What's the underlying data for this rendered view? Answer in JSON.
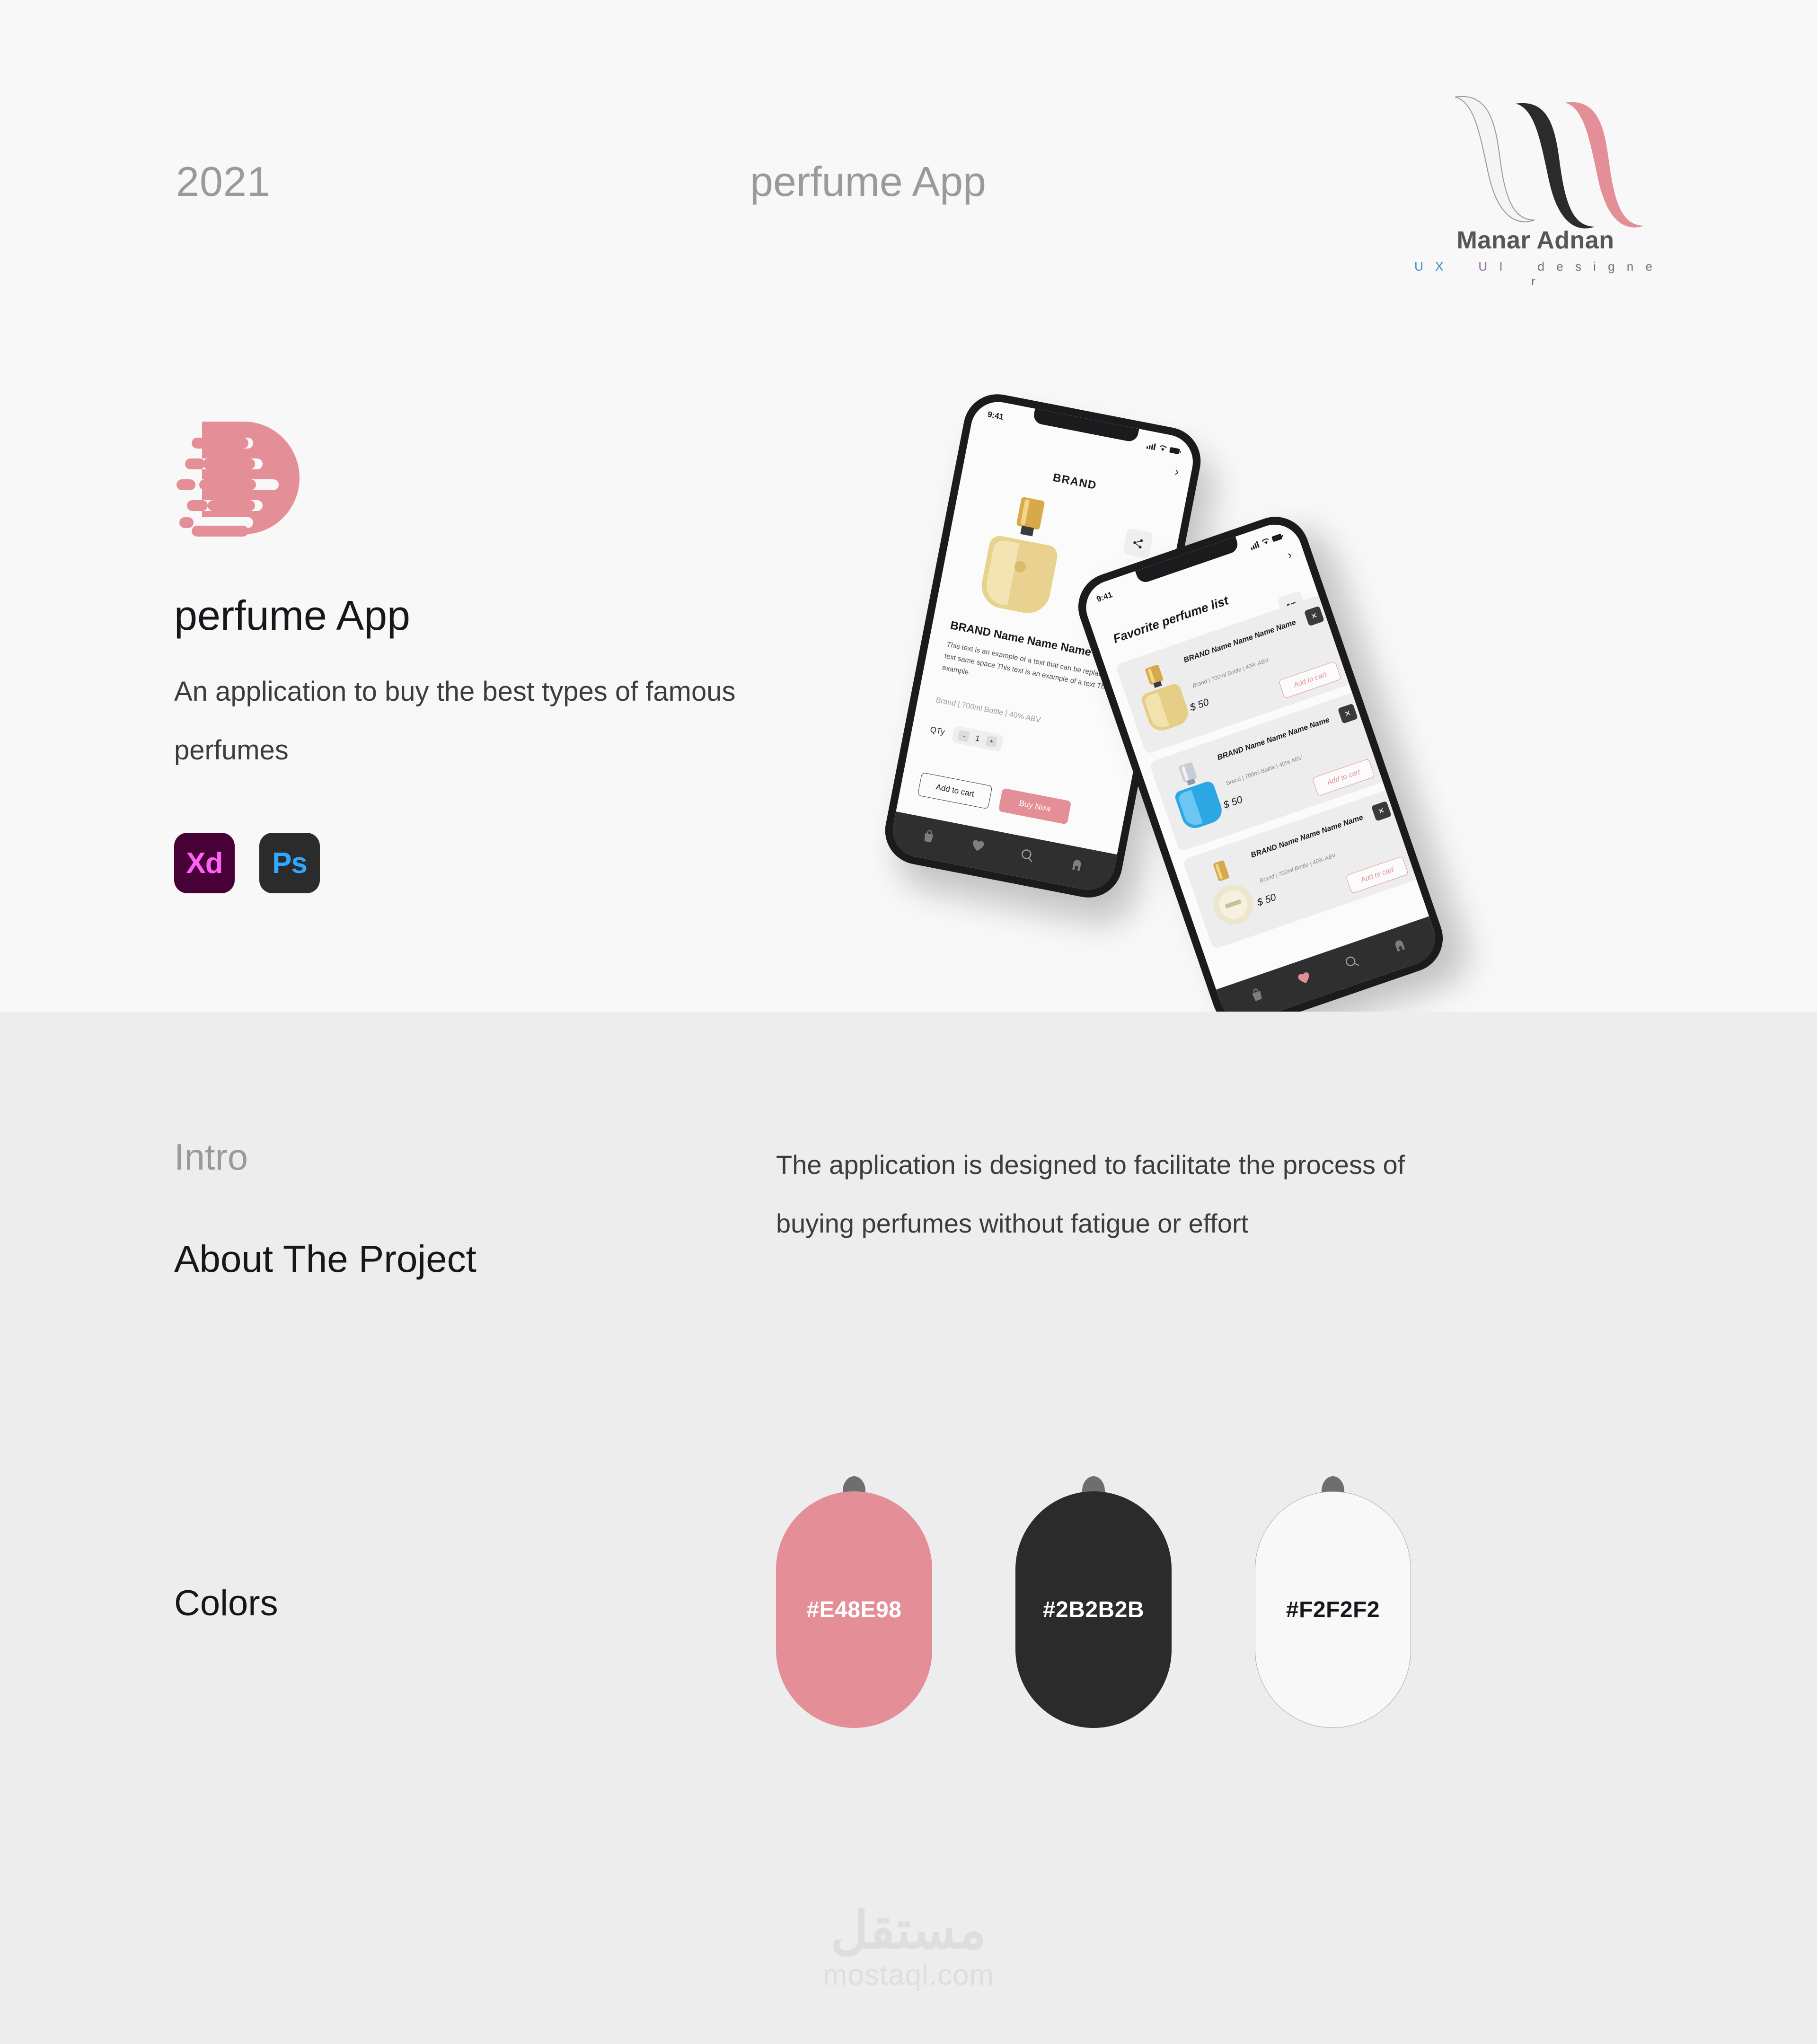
{
  "header": {
    "year": "2021",
    "project_label": "perfume App"
  },
  "brand": {
    "name": "Manar Adnan",
    "role_ux": "U X",
    "role_ui": "U I",
    "role_designer": "d e s i g n e r",
    "logo_colors": {
      "light": "#F2F2F2",
      "dark": "#2B2B2B",
      "pink": "#E48E98"
    }
  },
  "hero": {
    "app_title": "perfume App",
    "app_description": "An application to buy the best types of famous perfumes",
    "tools": [
      {
        "label": "Xd",
        "name": "Adobe XD",
        "bg": "#470137",
        "fg": "#FF61F6"
      },
      {
        "label": "Ps",
        "name": "Adobe Photoshop",
        "bg": "#2B2B2B",
        "fg": "#31A8FF"
      }
    ]
  },
  "mockup": {
    "phone1": {
      "status_time": "9:41",
      "brand": "BRAND",
      "product_name": "BRAND Name Name Name Name",
      "product_description": "This text is an example of a text that can be replaced in the of a text same space This text is an example of a text This text is an example",
      "product_meta": "Brand | 700ml Bottle | 40% ABV",
      "qty_label": "QTy",
      "qty_value": "1",
      "qty_minus": "−",
      "qty_plus": "+",
      "add_to_cart": "Add to cart",
      "buy_now": "Buy Now",
      "nav": [
        "bag-icon",
        "heart-icon",
        "search-icon",
        "home-icon"
      ]
    },
    "phone2": {
      "status_time": "9:41",
      "title": "Favorite perfume list",
      "cards": [
        {
          "name": "BRAND Name Name Name Name",
          "meta": "Brand | 700ml Bottle  | 40% ABV",
          "price": "$ 50",
          "action": "Add to cart",
          "remove": "✕",
          "bottle": "gold"
        },
        {
          "name": "BRAND Name Name Name Name",
          "meta": "Brand | 700ml Bottle  | 40% ABV",
          "price": "$ 50",
          "action": "Add to cart",
          "remove": "✕",
          "bottle": "blue"
        },
        {
          "name": "BRAND Name Name Name Name",
          "meta": "Brand | 700ml Bottle  | 40% ABV",
          "price": "$ 50",
          "action": "Add to cart",
          "remove": "✕",
          "bottle": "silver"
        }
      ],
      "nav": [
        "bag-icon",
        "heart-icon-active",
        "search-icon",
        "home-icon"
      ]
    }
  },
  "intro": {
    "label": "Intro",
    "title": "About The Project",
    "body": "The application is designed to facilitate the process of buying perfumes without fatigue or effort"
  },
  "colors": {
    "label": "Colors",
    "swatches": [
      {
        "hex": "#E48E98",
        "style": "pink"
      },
      {
        "hex": "#2B2B2B",
        "style": "dark"
      },
      {
        "hex": "#F2F2F2",
        "style": "light"
      }
    ]
  },
  "watermark": {
    "arabic": "مستقل",
    "latin": "mostaql.com"
  }
}
